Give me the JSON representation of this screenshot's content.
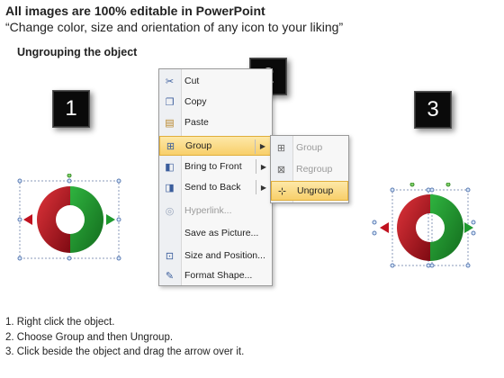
{
  "header": {
    "title": "All images are 100% editable in PowerPoint",
    "subtitle": "“Change color, size and orientation of any icon to your liking”",
    "section": "Ungrouping the object"
  },
  "badges": [
    "1",
    "2",
    "3"
  ],
  "context_menu": {
    "items": [
      {
        "label": "Cut",
        "icon": "scissors-icon"
      },
      {
        "label": "Copy",
        "icon": "copy-icon"
      },
      {
        "label": "Paste",
        "icon": "paste-icon"
      },
      {
        "label": "Group",
        "icon": "group-icon",
        "highlighted": true,
        "submenu": true
      },
      {
        "label": "Bring to Front",
        "icon": "bring-to-front-icon",
        "submenu": true
      },
      {
        "label": "Send to Back",
        "icon": "send-to-back-icon",
        "submenu": true
      },
      {
        "label": "Hyperlink...",
        "icon": "hyperlink-icon",
        "disabled": true
      },
      {
        "label": "Save as Picture...",
        "icon": "none"
      },
      {
        "label": "Size and Position...",
        "icon": "size-position-icon"
      },
      {
        "label": "Format Shape...",
        "icon": "format-shape-icon"
      }
    ]
  },
  "submenu": {
    "items": [
      {
        "label": "Group",
        "icon": "group-icon",
        "disabled": true
      },
      {
        "label": "Regroup",
        "icon": "regroup-icon",
        "disabled": true
      },
      {
        "label": "Ungroup",
        "icon": "ungroup-icon",
        "highlighted": true
      }
    ]
  },
  "colors": {
    "red": "#c0121f",
    "green": "#1f9a2e",
    "highlight": "#f8cf6a"
  },
  "steps": [
    "1.  Right click the object.",
    "2.  Choose Group and then Ungroup.",
    "3.  Click beside the object and drag the arrow over it."
  ]
}
